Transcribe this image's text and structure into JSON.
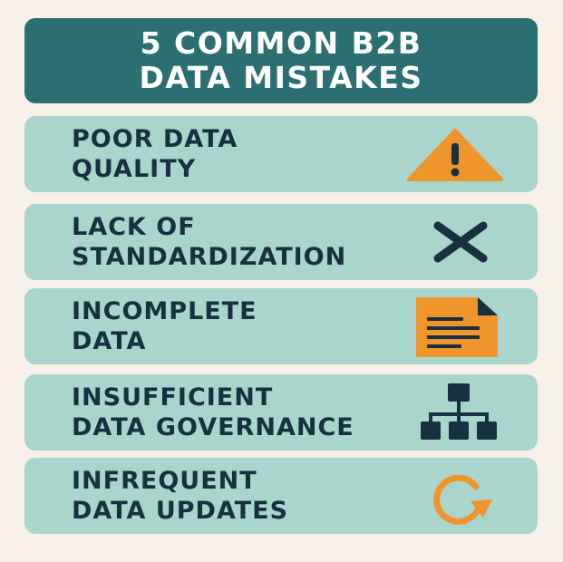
{
  "title": {
    "line1": "5 COMMON B2B",
    "line2": "DATA MISTAKES"
  },
  "items": [
    {
      "line1": "POOR DATA",
      "line2": "QUALITY",
      "icon": "warning-triangle-icon"
    },
    {
      "line1": "LACK OF",
      "line2": "STANDARDIZATION",
      "icon": "x-mark-icon"
    },
    {
      "line1": "INCOMPLETE",
      "line2": "DATA",
      "icon": "document-icon"
    },
    {
      "line1": "INSUFFICIENT",
      "line2": "DATA GOVERNANCE",
      "icon": "hierarchy-icon"
    },
    {
      "line1": "INFREQUENT",
      "line2": "DATA UPDATES",
      "icon": "refresh-arrow-icon"
    }
  ],
  "colors": {
    "background": "#f6f0e8",
    "header": "#2b6f73",
    "card": "#a9d5cd",
    "text": "#183040",
    "accent": "#f0952c"
  }
}
